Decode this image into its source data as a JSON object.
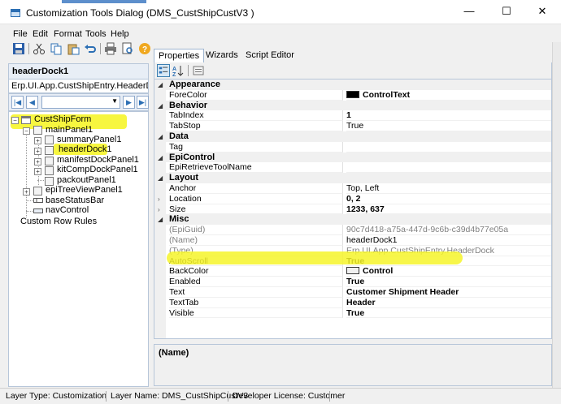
{
  "window": {
    "title": "Customization Tools Dialog  (DMS_CustShipCustV3 )",
    "minimize": "—",
    "maximize": "☐",
    "close": "✕"
  },
  "menu": [
    "File",
    "Edit",
    "Format",
    "Tools",
    "Help"
  ],
  "left": {
    "caption": "headerDock1",
    "class_name": "Erp.UI.App.CustShipEntry.HeaderDo",
    "nav": {
      "first": "|◀",
      "prev": "◀",
      "next": "▶",
      "last": "▶|",
      "combo_value": ""
    },
    "tree": {
      "root": "CustShipForm",
      "main_panel": "mainPanel1",
      "children": [
        "summaryPanel1",
        "headerDock1",
        "manifestDockPanel1",
        "kitCompDockPanel1",
        "packoutPanel1"
      ],
      "epi_tree": "epiTreeViewPanel1",
      "status_bar": "baseStatusBar",
      "nav_control": "navControl",
      "custom_rules": "Custom Row Rules"
    }
  },
  "tabs": [
    "Properties",
    "Wizards",
    "Script Editor"
  ],
  "grid": {
    "categories": {
      "appearance": "Appearance",
      "behavior": "Behavior",
      "data": "Data",
      "epicontrol": "EpiControl",
      "layout": "Layout",
      "misc": "Misc"
    },
    "props": {
      "forecolor": {
        "name": "ForeColor",
        "value": "ControlText"
      },
      "tabindex": {
        "name": "TabIndex",
        "value": "1"
      },
      "tabstop": {
        "name": "TabStop",
        "value": "True"
      },
      "tag": {
        "name": "Tag",
        "value": ""
      },
      "epiretrieve": {
        "name": "EpiRetrieveToolName",
        "value": ""
      },
      "anchor": {
        "name": "Anchor",
        "value": "Top, Left"
      },
      "location": {
        "name": "Location",
        "value": "0, 2"
      },
      "size": {
        "name": "Size",
        "value": "1233, 637"
      },
      "epiguid": {
        "name": "(EpiGuid)",
        "value": "90c7d418-a75a-447d-9c6b-c39d4b77e05a"
      },
      "name": {
        "name": "(Name)",
        "value": "headerDock1"
      },
      "type": {
        "name": "(Type)",
        "value": "Erp.UI.App.CustShipEntry.HeaderDock"
      },
      "autoscroll": {
        "name": "AutoScroll",
        "value": "True"
      },
      "backcolor": {
        "name": "BackColor",
        "value": "Control"
      },
      "enabled": {
        "name": "Enabled",
        "value": "True"
      },
      "text": {
        "name": "Text",
        "value": "Customer Shipment Header"
      },
      "texttab": {
        "name": "TextTab",
        "value": "Header"
      },
      "visible": {
        "name": "Visible",
        "value": "True"
      }
    }
  },
  "description": {
    "title": "(Name)"
  },
  "status": {
    "layer_type": "Layer Type:  Customization",
    "layer_name": "Layer Name:  DMS_CustShipCustV3",
    "license": "Developer License:  Customer"
  },
  "colors": {
    "highlight": "#f6f52a",
    "forecolor_swatch": "#000000",
    "backcolor_swatch": "#f0f0f0",
    "accent": "#2c6fb4"
  }
}
